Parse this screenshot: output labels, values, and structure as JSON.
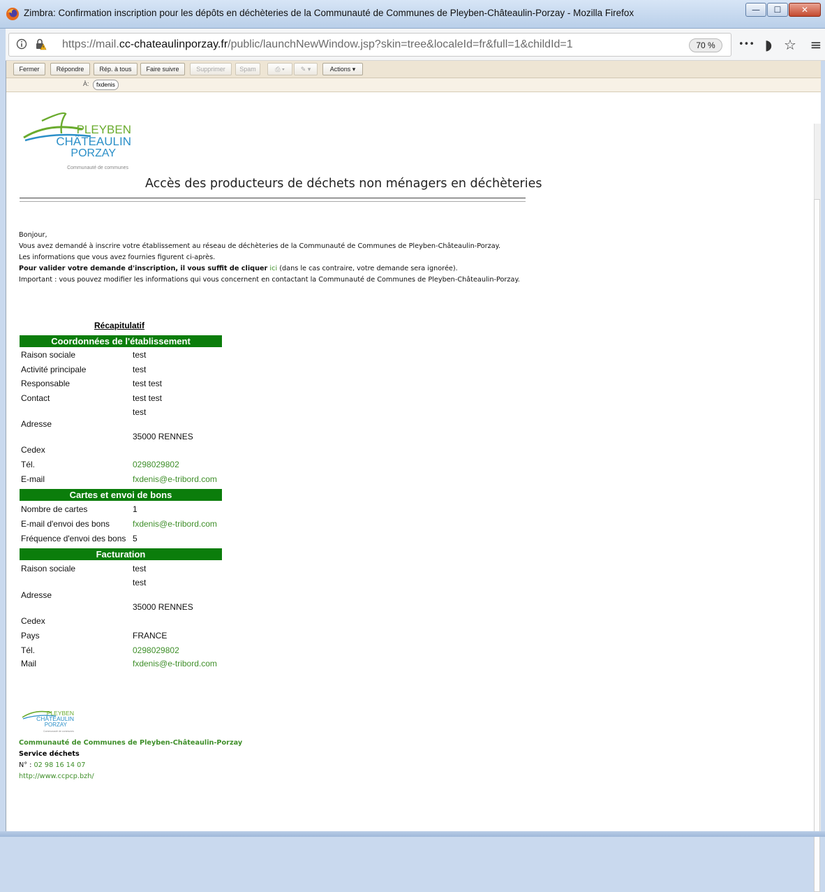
{
  "window": {
    "title": "Zimbra: Confirmation inscription pour les dépôts en déchèteries de la Communauté de Communes de Pleyben-Châteaulin-Porzay - Mozilla Firefox",
    "minimize": "—",
    "maximize": "☐",
    "close": "✕"
  },
  "browser": {
    "url_prefix": "https://mail.",
    "url_domain": "cc-chateaulinporzay.fr",
    "url_path": "/public/launchNewWindow.jsp?skin=tree&localeId=fr&full=1&childId=1",
    "zoom": "70 %",
    "menu_dots": "•••",
    "pocket": "◗",
    "star": "☆",
    "hamburger": "≡"
  },
  "toolbar": {
    "close_label": "Fermer",
    "reply_label": "Répondre",
    "reply_all_label": "Rép. à tous",
    "forward_label": "Faire suivre",
    "delete_label": "Supprimer",
    "spam_label": "Spam",
    "print_label": "⎙ ▾",
    "tag_label": "✎ ▾",
    "actions_label": "Actions ▾"
  },
  "header": {
    "to_label": "À:",
    "to_value": "fxdenis"
  },
  "email": {
    "logo": {
      "line1": "PLEYBEN",
      "line2": "CHÂTEAULIN",
      "line3": "PORZAY",
      "line4": "Communauté de communes"
    },
    "heading": "Accès des producteurs de déchets non ménagers en déchèteries",
    "greeting": "Bonjour,",
    "line1": "Vous avez demandé à inscrire votre établissement au réseau de déchèteries de la Communauté de Communes de Pleyben-Châteaulin-Porzay.",
    "line2": "Les informations que vous avez fournies figurent ci-après.",
    "line3_bold": "Pour valider votre demande d'inscription, il vous suffit de cliquer",
    "line3_link": "ici",
    "line3_rest": "(dans le cas contraire, votre demande sera ignorée).",
    "line4": "Important : vous pouvez modifier les informations qui vous concernent en contactant la Communauté de Communes de Pleyben-Châteaulin-Porzay.",
    "recap_title": "Récapitulatif",
    "sections": {
      "coords": {
        "title": "Coordonnées de l'établissement",
        "raison_label": "Raison sociale",
        "raison_value": "test",
        "activite_label": "Activité principale",
        "activite_value": "test",
        "responsable_label": "Responsable",
        "responsable_value": "test test",
        "contact_label": "Contact",
        "contact_value": "test test",
        "adresse_line1": "test",
        "adresse_label": "Adresse",
        "adresse_line2": "35000 RENNES",
        "cedex_label": "Cedex",
        "tel_label": "Tél.",
        "tel_value": "0298029802",
        "email_label": "E-mail",
        "email_value": "fxdenis@e-tribord.com"
      },
      "cartes": {
        "title": "Cartes et envoi de bons",
        "nb_label": "Nombre de cartes",
        "nb_value": "1",
        "mail_label": "E-mail d'envoi des bons",
        "mail_value": "fxdenis@e-tribord.com",
        "freq_label": "Fréquence d'envoi des bons",
        "freq_value": "5"
      },
      "facturation": {
        "title": "Facturation",
        "raison_label": "Raison sociale",
        "raison_value": "test",
        "adresse_line1": "test",
        "adresse_label": "Adresse",
        "adresse_line2": "35000 RENNES",
        "cedex_label": "Cedex",
        "pays_label": "Pays",
        "pays_value": "FRANCE",
        "tel_label": "Tél.",
        "tel_value": "0298029802",
        "mail_label": "Mail",
        "mail_value": "fxdenis@e-tribord.com"
      }
    },
    "signature": {
      "org": "Communauté de Communes de Pleyben-Châteaulin-Porzay",
      "service": "Service déchets",
      "phone_label": "N° : ",
      "phone_value": "02 98 16 14 07",
      "website": "http://www.ccpcp.bzh/"
    }
  },
  "colors": {
    "section_green": "#0b7d0b",
    "link_green": "#3f8f2a",
    "logo_green": "#6aab2e",
    "logo_blue": "#2b8fc8"
  }
}
